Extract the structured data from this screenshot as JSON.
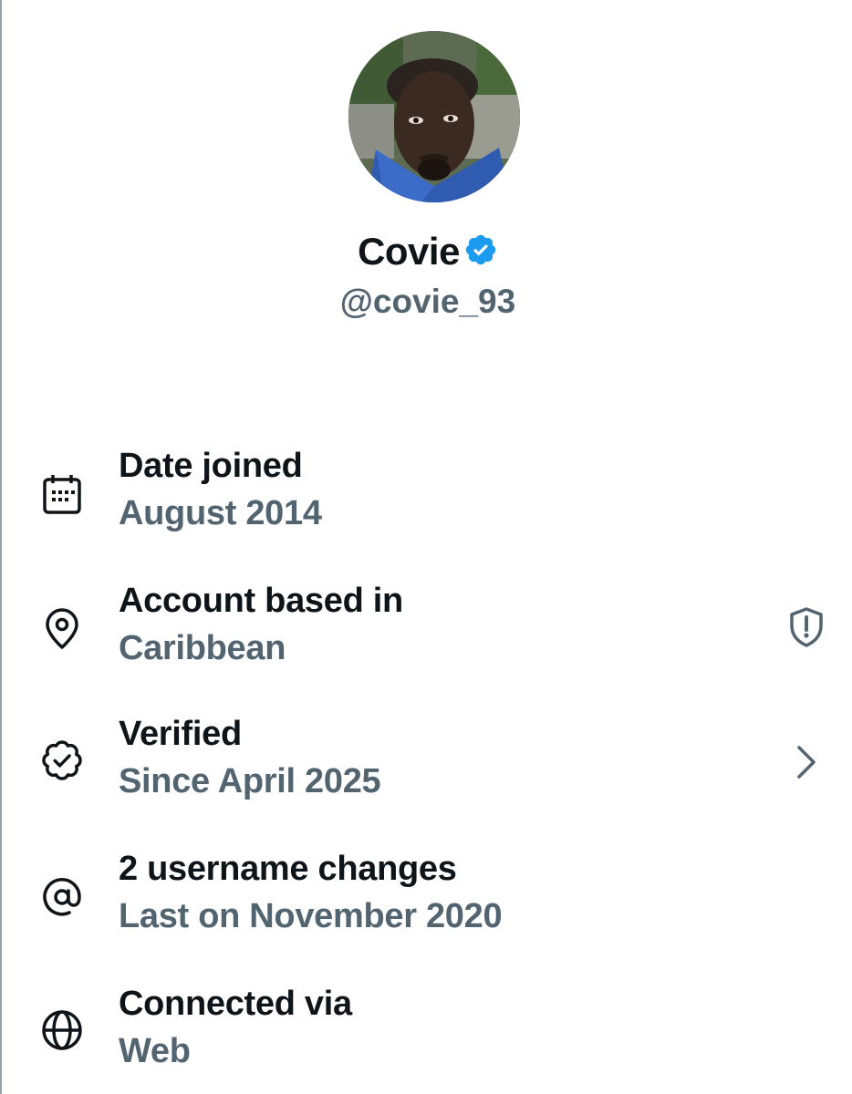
{
  "profile": {
    "name": "Covie",
    "handle": "@covie_93",
    "verified": true,
    "badge_color": "#1d9bf0"
  },
  "about_rows": [
    {
      "icon": "calendar-icon",
      "title": "Date joined",
      "value": "August 2014"
    },
    {
      "icon": "location-pin-icon",
      "title": "Account based in",
      "value": "Caribbean",
      "right_icon": "shield-alert-icon"
    },
    {
      "icon": "verified-badge-outline-icon",
      "title": "Verified",
      "value": "Since April 2025",
      "right_icon": "chevron-right-icon"
    },
    {
      "icon": "at-sign-icon",
      "title": "2 username changes",
      "value": "Last on November 2020"
    },
    {
      "icon": "globe-icon",
      "title": "Connected via",
      "value": "Web"
    }
  ],
  "colors": {
    "primary_text": "#0f1419",
    "secondary_text": "#536471",
    "verified_blue": "#1d9bf0"
  }
}
